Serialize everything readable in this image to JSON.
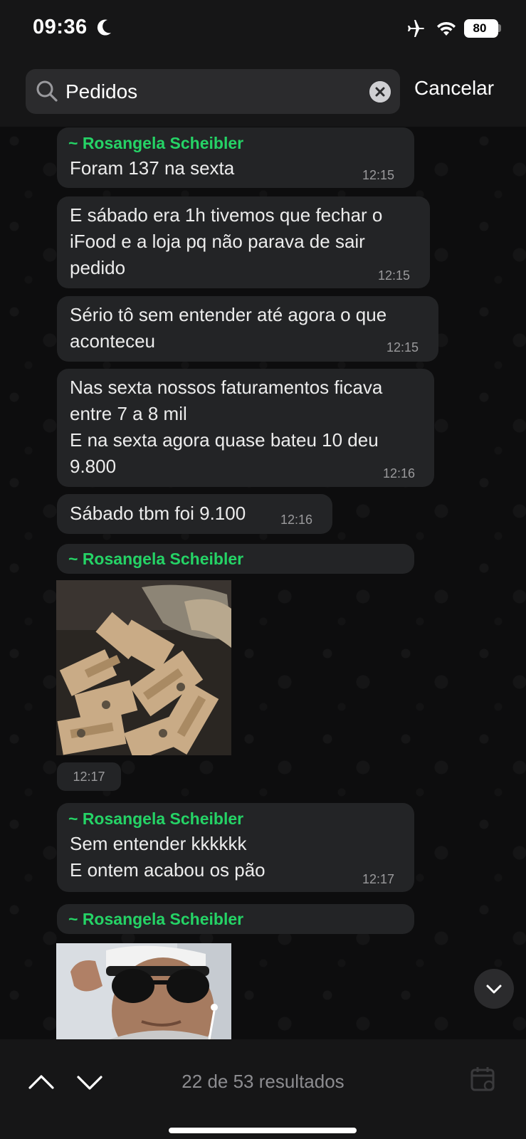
{
  "status_bar": {
    "time": "09:36",
    "battery": "80",
    "battery_level": 0.8
  },
  "search": {
    "query": "Pedidos",
    "cancel_label": "Cancelar"
  },
  "messages": [
    {
      "sender": "~ Rosangela Scheibler",
      "text": "Foram 137 na sexta",
      "time": "12:15"
    },
    {
      "text": "E sábado era 1h tivemos que fechar o\niFood e a loja pq não parava de sair\npedido",
      "time": "12:15"
    },
    {
      "text": "Sério tô sem entender até agora o que\naconteceu",
      "time": "12:15"
    },
    {
      "text": "Nas sexta nossos faturamentos ficava\nentre 7 a 8 mil\nE na sexta agora quase bateu 10 deu\n9.800",
      "time": "12:16"
    },
    {
      "text": "Sábado tbm foi 9.100",
      "time": "12:16"
    },
    {
      "sender": "~ Rosangela Scheibler",
      "media": "photo-of-money",
      "time": "12:17"
    },
    {
      "sender": "~ Rosangela Scheibler",
      "text": "Sem entender kkkkkk\nE ontem acabou os pão",
      "time": "12:17"
    },
    {
      "sender": "~ Rosangela Scheibler",
      "media": "photo-of-person-in-sunglasses"
    }
  ],
  "bottom_bar": {
    "result_count": "22 de 53 resultados"
  },
  "colors": {
    "sender": "#25d366",
    "bubble": "#232426",
    "background": "#0d0d0e"
  },
  "icons": [
    "moon-icon",
    "airplane-icon",
    "wifi-icon",
    "battery-icon",
    "search-icon",
    "clear-icon",
    "chevron-down-icon",
    "chevron-up-icon",
    "calendar-icon"
  ]
}
